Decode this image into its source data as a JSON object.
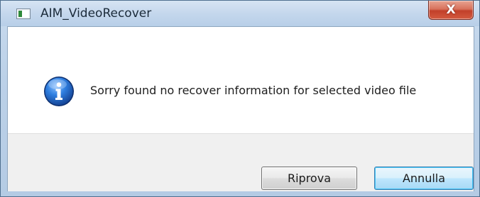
{
  "window": {
    "title": "AIM_VideoRecover",
    "close_glyph": "X"
  },
  "dialog": {
    "icon": "info-icon",
    "message": "Sorry found no recover information for selected video file"
  },
  "buttons": {
    "retry_label": "Riprova",
    "cancel_label": "Annulla"
  },
  "colors": {
    "title_bar": "#c3d6ec",
    "close_button": "#c2402a",
    "info_icon": "#1f5fb8",
    "default_button_border": "#3c7fb1"
  }
}
